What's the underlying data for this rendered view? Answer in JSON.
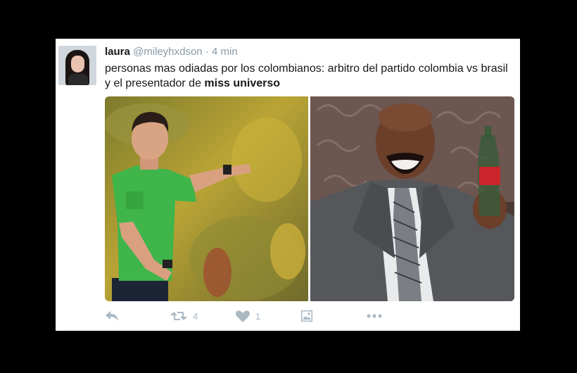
{
  "tweet": {
    "display_name": "laura",
    "handle": "@mileyhxdson",
    "separator": "·",
    "time": "4 min",
    "text_main": "personas mas odiadas por los colombianos: arbitro del partido colombia vs brasil y el presentador de ",
    "text_bold": "miss universo"
  },
  "actions": {
    "reply_icon": "reply-icon",
    "retweet_icon": "retweet-icon",
    "retweet_count": "4",
    "like_icon": "heart-icon",
    "like_count": "1",
    "image_icon": "image-icon",
    "more_icon": "more-icon"
  },
  "colors": {
    "background": "#000000",
    "card": "#ffffff",
    "text": "#14171a",
    "muted": "#8899a6",
    "action_icon": "#aab8c2"
  }
}
